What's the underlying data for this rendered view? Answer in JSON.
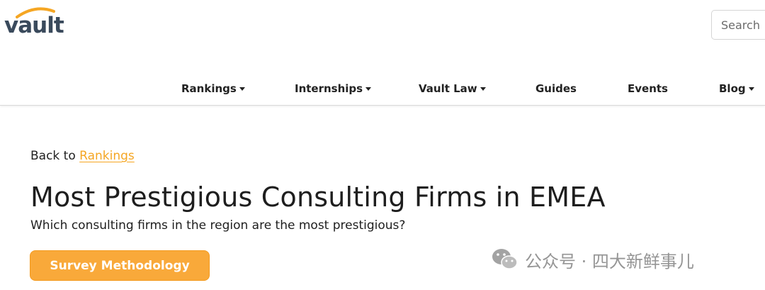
{
  "brand": {
    "logo_text": "vault",
    "accent_color": "#f5a623",
    "logo_color": "#3a4a5c"
  },
  "search": {
    "placeholder": "Search"
  },
  "nav": {
    "items": [
      {
        "label": "Rankings",
        "has_dropdown": true
      },
      {
        "label": "Internships",
        "has_dropdown": true
      },
      {
        "label": "Vault Law",
        "has_dropdown": true
      },
      {
        "label": "Guides",
        "has_dropdown": false
      },
      {
        "label": "Events",
        "has_dropdown": false
      },
      {
        "label": "Blog",
        "has_dropdown": true
      }
    ]
  },
  "breadcrumb": {
    "prefix": "Back to",
    "link_label": "Rankings"
  },
  "page": {
    "title": "Most Prestigious Consulting Firms in EMEA",
    "subtitle": "Which consulting firms in the region are the most prestigious?",
    "cta_label": "Survey Methodology"
  },
  "watermark": {
    "text": "公众号 · 四大新鲜事儿",
    "icon": "wechat-icon"
  }
}
